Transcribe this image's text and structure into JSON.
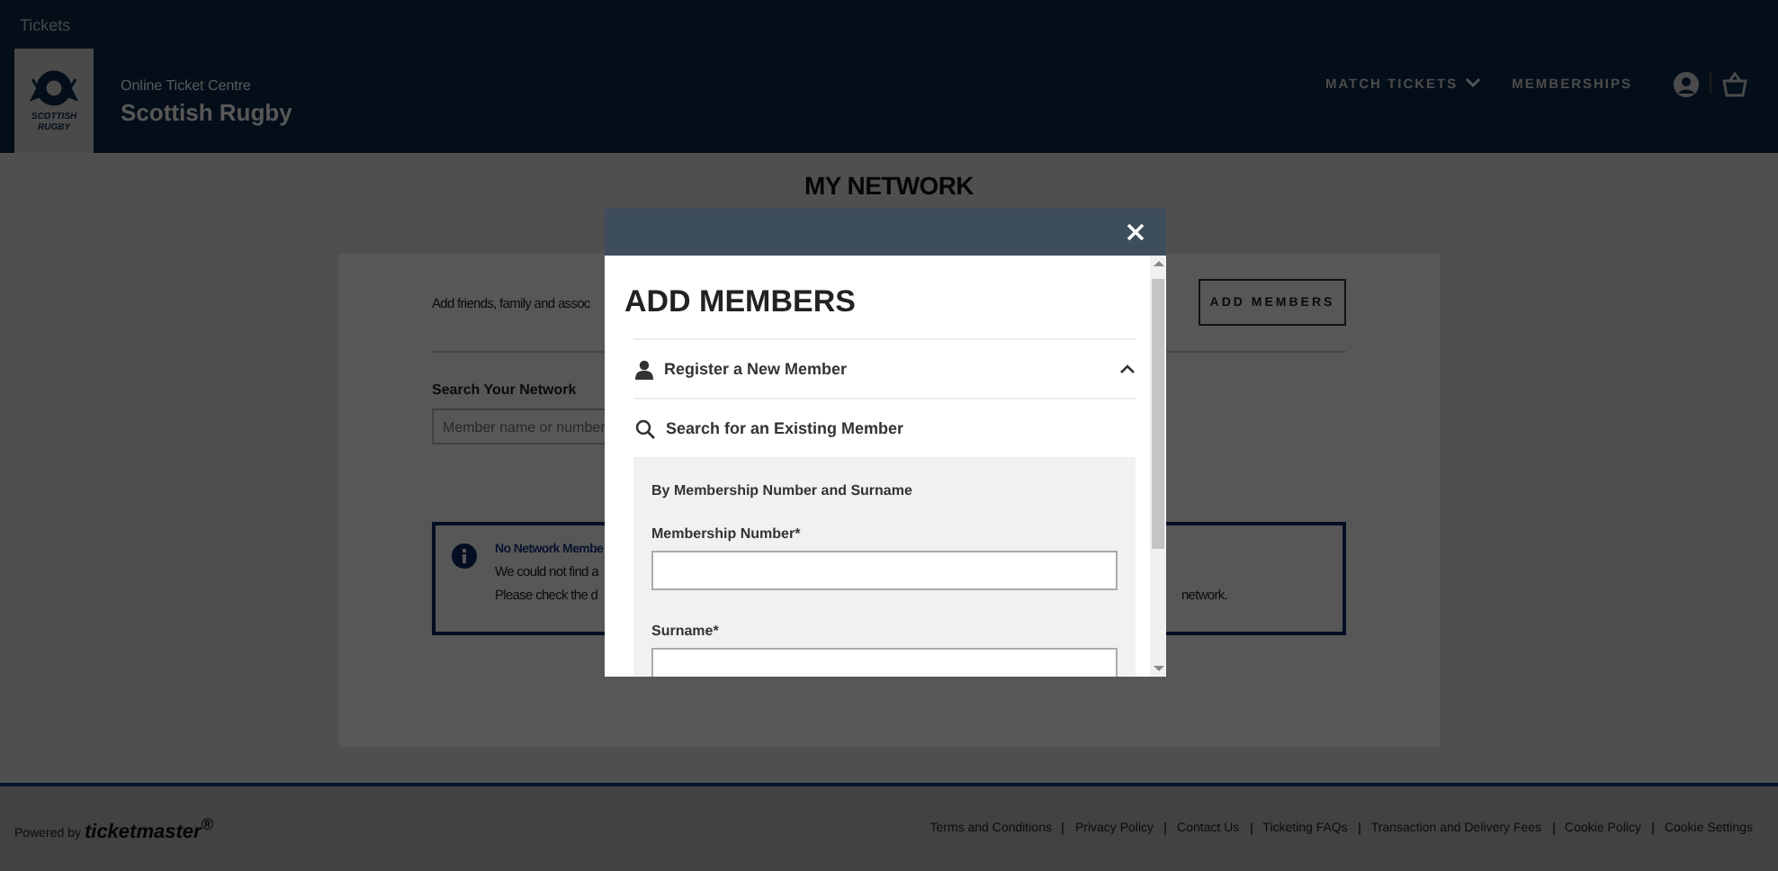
{
  "header": {
    "top_link": "Tickets",
    "logo_lines": [
      "SCOTTISH",
      "RUGBY"
    ],
    "subtitle": "Online Ticket Centre",
    "title": "Scottish Rugby",
    "nav": [
      {
        "label": "MATCH TICKETS",
        "kind": "dropdown"
      },
      {
        "label": "MEMBERSHIPS",
        "kind": "link"
      }
    ]
  },
  "page": {
    "title": "MY NETWORK",
    "intro": "Add friends, family and assoc",
    "add_button": "ADD MEMBERS",
    "search_label": "Search Your Network",
    "search": {
      "placeholder": "Member name or number"
    },
    "notice": {
      "title": "No Network Membe",
      "lines": [
        {
          "left": "We could not find a"
        },
        {
          "left": "Please check the d",
          "right": "network."
        }
      ]
    }
  },
  "modal": {
    "title": "ADD MEMBERS",
    "sections": [
      {
        "label": "Register a New Member",
        "kind": "person"
      },
      {
        "label": "Search for an Existing Member",
        "kind": "search"
      }
    ],
    "form": {
      "heading": "By Membership Number and Surname",
      "fields": [
        {
          "label": "Membership Number*"
        },
        {
          "label": "Surname*"
        }
      ]
    }
  },
  "footer": {
    "powered_by": "Powered by",
    "brand": "ticketmaster$^{®}$",
    "links": [
      "Terms and Conditions",
      "Privacy Policy",
      "Contact Us",
      "Ticketing FAQs",
      "Transaction and Delivery Fees",
      "Cookie Policy",
      "Cookie Settings"
    ]
  }
}
